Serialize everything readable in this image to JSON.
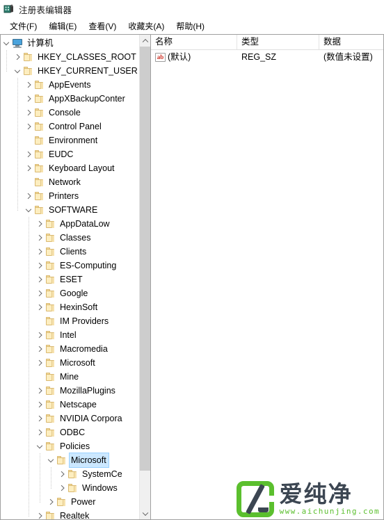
{
  "window": {
    "title": "注册表编辑器",
    "icon": "registry-editor-icon"
  },
  "menubar": {
    "items": [
      {
        "label": "文件(F)",
        "name": "menu-file"
      },
      {
        "label": "编辑(E)",
        "name": "menu-edit"
      },
      {
        "label": "查看(V)",
        "name": "menu-view"
      },
      {
        "label": "收藏夹(A)",
        "name": "menu-favorites"
      },
      {
        "label": "帮助(H)",
        "name": "menu-help"
      }
    ]
  },
  "tree": {
    "scrollbar": {
      "up_arrow": "chevron-up-icon",
      "down_arrow": "chevron-down-icon"
    },
    "nodes": [
      {
        "label": "计算机",
        "depth": 0,
        "state": "open",
        "icon": "computer-icon",
        "selected": false
      },
      {
        "label": "HKEY_CLASSES_ROOT",
        "depth": 1,
        "state": "closed",
        "icon": "folder-icon",
        "selected": false
      },
      {
        "label": "HKEY_CURRENT_USER",
        "depth": 1,
        "state": "open",
        "icon": "folder-icon",
        "selected": false
      },
      {
        "label": "AppEvents",
        "depth": 2,
        "state": "closed",
        "icon": "folder-icon",
        "selected": false
      },
      {
        "label": "AppXBackupConter",
        "depth": 2,
        "state": "closed",
        "icon": "folder-icon",
        "selected": false
      },
      {
        "label": "Console",
        "depth": 2,
        "state": "closed",
        "icon": "folder-icon",
        "selected": false
      },
      {
        "label": "Control Panel",
        "depth": 2,
        "state": "closed",
        "icon": "folder-icon",
        "selected": false
      },
      {
        "label": "Environment",
        "depth": 2,
        "state": "leaf",
        "icon": "folder-icon",
        "selected": false
      },
      {
        "label": "EUDC",
        "depth": 2,
        "state": "closed",
        "icon": "folder-icon",
        "selected": false
      },
      {
        "label": "Keyboard Layout",
        "depth": 2,
        "state": "closed",
        "icon": "folder-icon",
        "selected": false
      },
      {
        "label": "Network",
        "depth": 2,
        "state": "leaf",
        "icon": "folder-icon",
        "selected": false
      },
      {
        "label": "Printers",
        "depth": 2,
        "state": "closed",
        "icon": "folder-icon",
        "selected": false
      },
      {
        "label": "SOFTWARE",
        "depth": 2,
        "state": "open",
        "icon": "folder-icon",
        "selected": false
      },
      {
        "label": "AppDataLow",
        "depth": 3,
        "state": "closed",
        "icon": "folder-icon",
        "selected": false
      },
      {
        "label": "Classes",
        "depth": 3,
        "state": "closed",
        "icon": "folder-icon",
        "selected": false
      },
      {
        "label": "Clients",
        "depth": 3,
        "state": "closed",
        "icon": "folder-icon",
        "selected": false
      },
      {
        "label": "ES-Computing",
        "depth": 3,
        "state": "closed",
        "icon": "folder-icon",
        "selected": false
      },
      {
        "label": "ESET",
        "depth": 3,
        "state": "closed",
        "icon": "folder-icon",
        "selected": false
      },
      {
        "label": "Google",
        "depth": 3,
        "state": "closed",
        "icon": "folder-icon",
        "selected": false
      },
      {
        "label": "HexinSoft",
        "depth": 3,
        "state": "closed",
        "icon": "folder-icon",
        "selected": false
      },
      {
        "label": "IM Providers",
        "depth": 3,
        "state": "leaf",
        "icon": "folder-icon",
        "selected": false
      },
      {
        "label": "Intel",
        "depth": 3,
        "state": "closed",
        "icon": "folder-icon",
        "selected": false
      },
      {
        "label": "Macromedia",
        "depth": 3,
        "state": "closed",
        "icon": "folder-icon",
        "selected": false
      },
      {
        "label": "Microsoft",
        "depth": 3,
        "state": "closed",
        "icon": "folder-icon",
        "selected": false
      },
      {
        "label": "Mine",
        "depth": 3,
        "state": "leaf",
        "icon": "folder-icon",
        "selected": false
      },
      {
        "label": "MozillaPlugins",
        "depth": 3,
        "state": "closed",
        "icon": "folder-icon",
        "selected": false
      },
      {
        "label": "Netscape",
        "depth": 3,
        "state": "closed",
        "icon": "folder-icon",
        "selected": false
      },
      {
        "label": "NVIDIA Corpora",
        "depth": 3,
        "state": "closed",
        "icon": "folder-icon",
        "selected": false
      },
      {
        "label": "ODBC",
        "depth": 3,
        "state": "closed",
        "icon": "folder-icon",
        "selected": false
      },
      {
        "label": "Policies",
        "depth": 3,
        "state": "open",
        "icon": "folder-icon",
        "selected": false
      },
      {
        "label": "Microsoft",
        "depth": 4,
        "state": "open",
        "icon": "folder-icon",
        "selected": true
      },
      {
        "label": "SystemCe",
        "depth": 5,
        "state": "closed",
        "icon": "folder-icon",
        "selected": false
      },
      {
        "label": "Windows",
        "depth": 5,
        "state": "closed",
        "icon": "folder-icon",
        "selected": false
      },
      {
        "label": "Power",
        "depth": 4,
        "state": "closed",
        "icon": "folder-icon",
        "selected": false
      },
      {
        "label": "Realtek",
        "depth": 3,
        "state": "closed",
        "icon": "folder-icon",
        "selected": false
      }
    ]
  },
  "values": {
    "columns": [
      {
        "label": "名称",
        "name": "column-name"
      },
      {
        "label": "类型",
        "name": "column-type"
      },
      {
        "label": "数据",
        "name": "column-data"
      }
    ],
    "rows": [
      {
        "icon": "string-value-icon",
        "icon_text": "ab",
        "name": "(默认)",
        "type": "REG_SZ",
        "data": "(数值未设置)"
      }
    ]
  },
  "watermark": {
    "brand": "爱纯净",
    "url": "www.aichunjing.com",
    "green": "#5bbf2e",
    "dark": "#3c4652"
  }
}
